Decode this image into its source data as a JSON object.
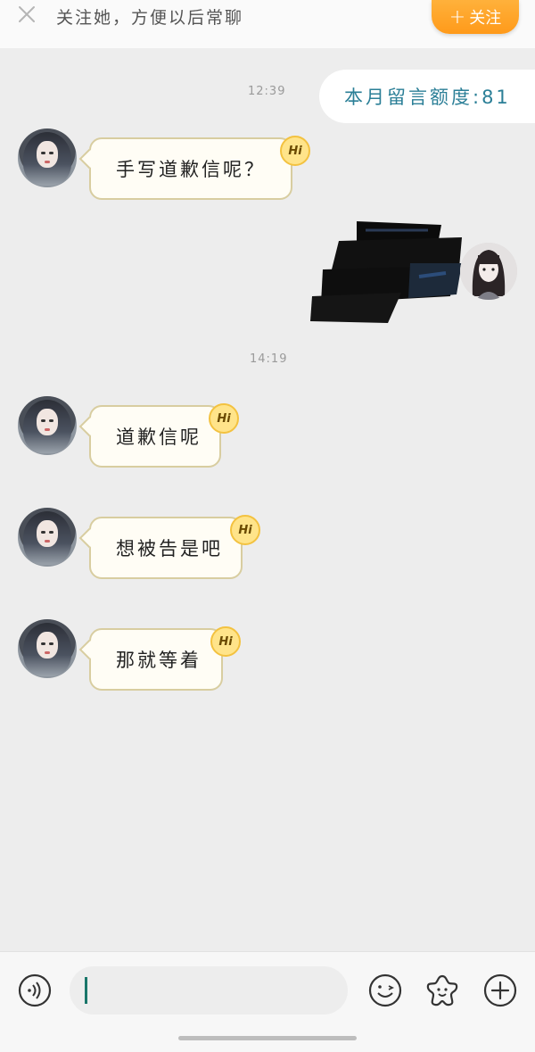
{
  "topbar": {
    "text": "关注她，方便以后常聊",
    "follow_label": "关注",
    "follow_plus": "+"
  },
  "quota": {
    "label": "本月留言额度:81"
  },
  "times": [
    "12:39",
    "14:19"
  ],
  "messages": [
    {
      "sender": "other",
      "text": "手写道歉信呢？",
      "badge": "Hi"
    },
    {
      "sender": "me",
      "content": "scribbled-out image"
    },
    {
      "sender": "other",
      "text": "道歉信呢",
      "badge": "Hi"
    },
    {
      "sender": "other",
      "text": "想被告是吧",
      "badge": "Hi"
    },
    {
      "sender": "other",
      "text": "那就等着",
      "badge": "Hi"
    }
  ],
  "bottom": {
    "icons": [
      "voice-icon",
      "emoji-icon",
      "sticker-icon",
      "plus-icon"
    ]
  },
  "colors": {
    "background": "#ededed",
    "follow_button": "#ff9a1a",
    "quota_text": "#2b7f97",
    "bubble_border": "#d8cda0",
    "badge": "#ffe48a"
  }
}
